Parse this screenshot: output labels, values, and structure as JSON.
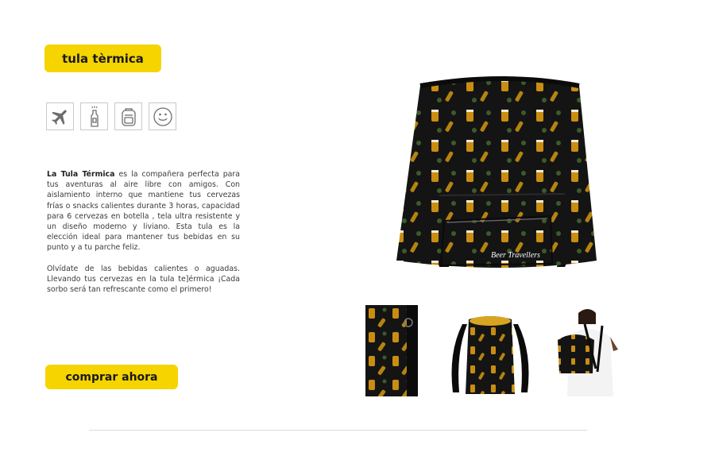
{
  "product": {
    "title": "tula tèrmica",
    "description_intro_bold": "La Tula Térmica",
    "description_intro_rest": " es la compañera perfecta para tus aventuras al aire libre con amigos. Con aislamiento interno que mantiene tus cervezas frías o snacks calientes durante 3 horas, capacidad para 6 cervezas en botella , tela ultra resistente y un diseño moderno y liviano. Esta tula es la elección ideal para mantener tus bebidas en su punto y a tu parche feliz.",
    "description_second": "Olvídate de las bebidas calientes o aguadas. Llevando tus cervezas en la tula te]érmica ¡Cada sorbo será tan refrescante como el primero!",
    "buy_label": "comprar ahora"
  },
  "features": [
    {
      "icon": "airplane-icon"
    },
    {
      "icon": "beer-bottle-icon"
    },
    {
      "icon": "backpack-icon"
    },
    {
      "icon": "smiley-icon"
    }
  ],
  "images": {
    "brand_label": "Beer Travellers"
  },
  "colors": {
    "accent": "#f5d400",
    "bag": "#111111",
    "icon_gray": "#6d6d6d"
  }
}
